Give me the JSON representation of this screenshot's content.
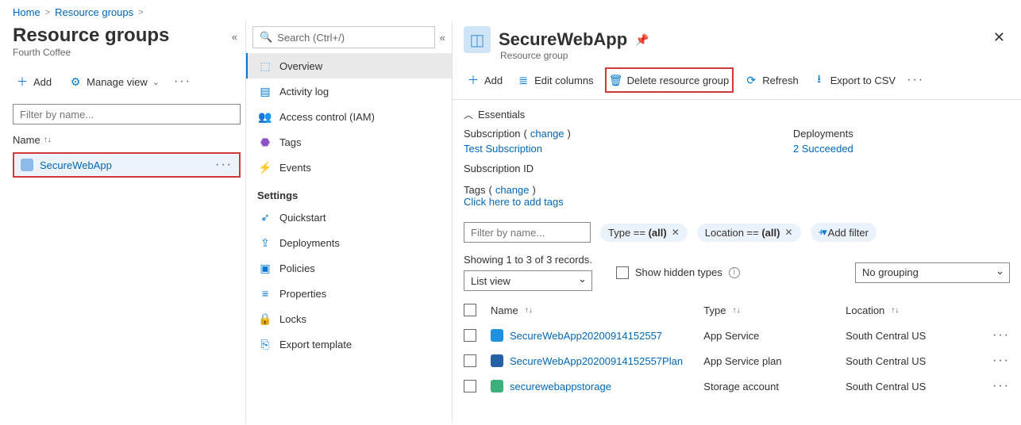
{
  "breadcrumb": {
    "home": "Home",
    "rg": "Resource groups"
  },
  "leftPanel": {
    "title": "Resource groups",
    "tenant": "Fourth Coffee",
    "add": "Add",
    "manageView": "Manage view",
    "filterPlaceholder": "Filter by name...",
    "nameCol": "Name",
    "item": "SecureWebApp"
  },
  "midNav": {
    "searchPlaceholder": "Search (Ctrl+/)",
    "overview": "Overview",
    "activity": "Activity log",
    "iam": "Access control (IAM)",
    "tags": "Tags",
    "events": "Events",
    "settingsHeader": "Settings",
    "quickstart": "Quickstart",
    "deployments": "Deployments",
    "policies": "Policies",
    "properties": "Properties",
    "locks": "Locks",
    "exportTemplate": "Export template"
  },
  "main": {
    "title": "SecureWebApp",
    "subtitle": "Resource group",
    "toolbar": {
      "add": "Add",
      "editColumns": "Edit columns",
      "deleteRg": "Delete resource group",
      "refresh": "Refresh",
      "exportCsv": "Export to CSV"
    },
    "essentials": {
      "header": "Essentials",
      "subscriptionLabel": "Subscription",
      "change": "change",
      "subscriptionValue": "Test Subscription",
      "subscriptionIdLabel": "Subscription ID",
      "deploymentsLabel": "Deployments",
      "deploymentsValue": "2 Succeeded"
    },
    "tags": {
      "label": "Tags",
      "change": "change",
      "addLink": "Click here to add tags"
    },
    "filters": {
      "placeholder": "Filter by name...",
      "typePrefix": "Type == ",
      "all": "(all)",
      "locationPrefix": "Location == ",
      "addFilter": "Add filter"
    },
    "meta": {
      "showing": "Showing 1 to 3 of 3 records.",
      "listView": "List view",
      "showHidden": "Show hidden types",
      "noGrouping": "No grouping"
    },
    "table": {
      "cols": {
        "name": "Name",
        "type": "Type",
        "location": "Location"
      },
      "rows": [
        {
          "name": "SecureWebApp20200914152557",
          "type": "App Service",
          "location": "South Central US",
          "iconColor": "#1f90e0"
        },
        {
          "name": "SecureWebApp20200914152557Plan",
          "type": "App Service plan",
          "location": "South Central US",
          "iconColor": "#2461a8"
        },
        {
          "name": "securewebappstorage",
          "type": "Storage account",
          "location": "South Central US",
          "iconColor": "#3cb07a"
        }
      ]
    }
  }
}
